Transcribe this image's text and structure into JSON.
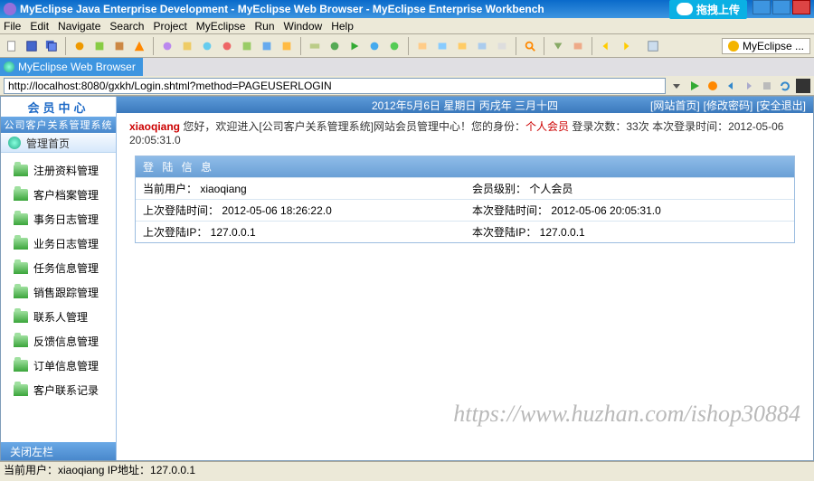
{
  "titlebar": {
    "text": "MyEclipse Java Enterprise Development - MyEclipse Web Browser - MyEclipse Enterprise Workbench",
    "upload_label": "拖拽上传"
  },
  "menubar": [
    "File",
    "Edit",
    "Navigate",
    "Search",
    "Project",
    "MyEclipse",
    "Run",
    "Window",
    "Help"
  ],
  "toolbar": {
    "mye_label": "MyEclipse ..."
  },
  "browser_tab": {
    "label": "MyEclipse Web Browser"
  },
  "addrbar": {
    "url": "http://localhost:8080/gxkh/Login.shtml?method=PAGEUSERLOGIN"
  },
  "sidebar": {
    "logo": "会员中心",
    "sub": "公司客户关系管理系统",
    "head": "管理首页",
    "items": [
      "注册资料管理",
      "客户档案管理",
      "事务日志管理",
      "业务日志管理",
      "任务信息管理",
      "销售跟踪管理",
      "联系人管理",
      "反馈信息管理",
      "订单信息管理",
      "客户联系记录"
    ],
    "foot": "关闭左栏"
  },
  "page_head": {
    "date": "2012年5月6日 星期日 丙戌年 三月十四",
    "links": [
      "[网站首页]",
      "[修改密码]",
      "[安全退出]"
    ]
  },
  "welcome": {
    "user": "xiaoqiang",
    "t1": " 您好，欢迎进入[公司客户关系管理系统]网站会员管理中心！您的身份：",
    "role": "个人会员",
    "t2": " 登录次数：33次 本次登录时间：2012-05-06 20:05:31.0"
  },
  "info": {
    "head": "登 陆 信 息",
    "rows": [
      {
        "l": "当前用户： xiaoqiang",
        "r": "会员级别： 个人会员"
      },
      {
        "l": "上次登陆时间： 2012-05-06 18:26:22.0",
        "r": "本次登陆时间： 2012-05-06 20:05:31.0"
      },
      {
        "l": "上次登陆IP： 127.0.0.1",
        "r": "本次登陆IP： 127.0.0.1"
      }
    ]
  },
  "watermark": "https://www.huzhan.com/ishop30884",
  "statusbar": "当前用户：xiaoqiang  IP地址：127.0.0.1"
}
